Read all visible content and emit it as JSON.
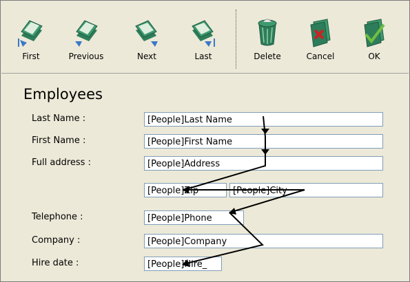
{
  "toolbar": {
    "buttons": [
      {
        "label": "First",
        "icon": "first-record-icon"
      },
      {
        "label": "Previous",
        "icon": "previous-record-icon"
      },
      {
        "label": "Next",
        "icon": "next-record-icon"
      },
      {
        "label": "Last",
        "icon": "last-record-icon"
      },
      {
        "label": "Delete",
        "icon": "trash-icon"
      },
      {
        "label": "Cancel",
        "icon": "cancel-icon"
      },
      {
        "label": "OK",
        "icon": "ok-icon"
      }
    ]
  },
  "form": {
    "title": "Employees",
    "labels": {
      "last_name": "Last Name :",
      "first_name": "First Name :",
      "full_address": "Full address :",
      "telephone": "Telephone :",
      "company": "Company :",
      "hire_date": "Hire date :"
    },
    "fields": {
      "last_name": "[People]Last Name",
      "first_name": "[People]First Name",
      "address": "[People]Address",
      "zip": "[People]Zip",
      "city": "[People]City",
      "phone": "[People]Phone",
      "company": "[People]Company",
      "hire": "[People]Hire_"
    }
  },
  "colors": {
    "folder_green": "#2e7d5a",
    "arrow_blue": "#3a78c8",
    "delete_red": "#cc2222",
    "ok_check": "#6fc040"
  }
}
